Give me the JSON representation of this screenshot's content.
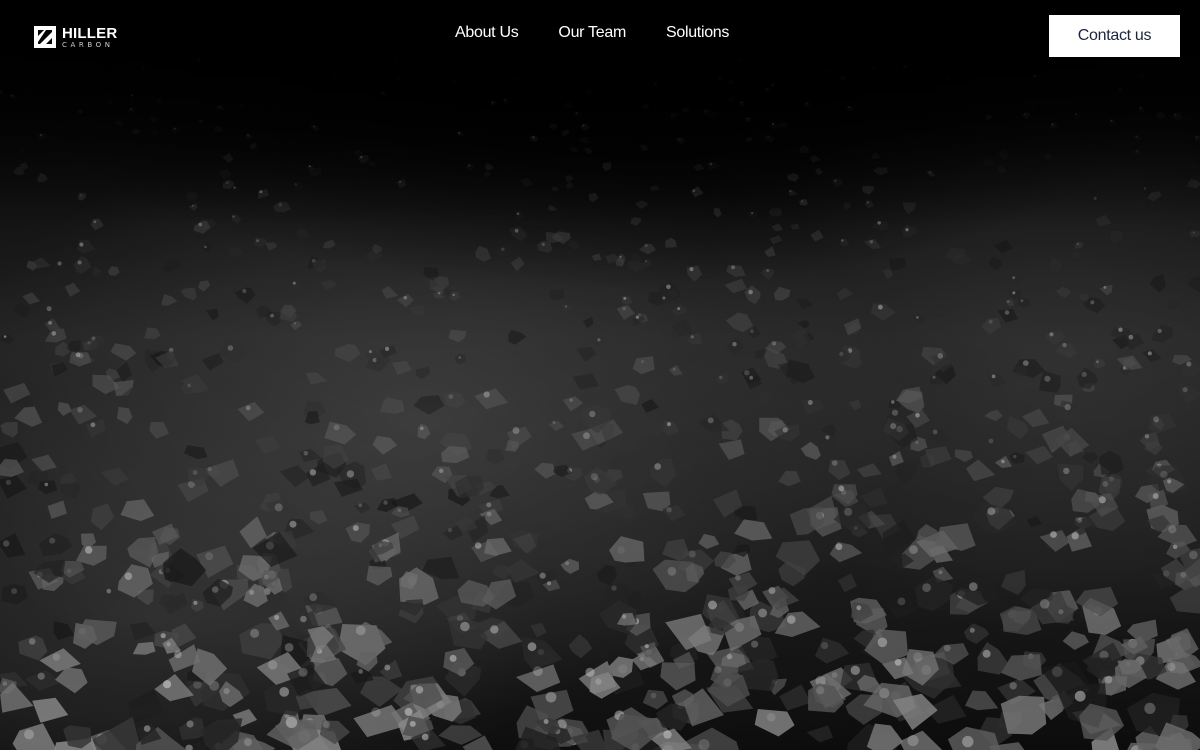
{
  "header": {
    "logo": {
      "name": "HILLER",
      "subtitle": "CARBON",
      "icon": "hiller-logo-mark-icon"
    },
    "nav": {
      "items": [
        {
          "label": "About Us"
        },
        {
          "label": "Our Team"
        },
        {
          "label": "Solutions"
        }
      ]
    },
    "cta": {
      "label": "Contact us"
    }
  },
  "hero": {
    "image": "carbon-granules-photo"
  },
  "colors": {
    "background": "#050505",
    "nav_text": "#ffffff",
    "cta_background": "#ffffff",
    "cta_text": "#1b2540"
  }
}
